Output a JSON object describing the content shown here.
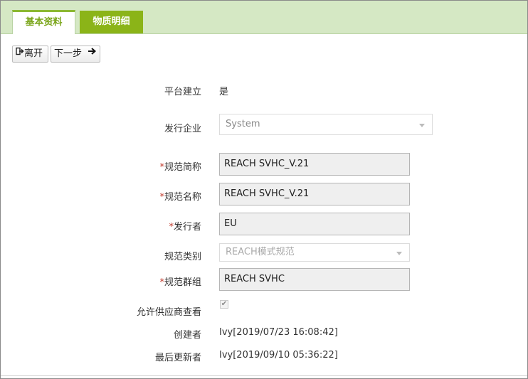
{
  "tabs": [
    {
      "label": "基本资料",
      "active": true
    },
    {
      "label": "物质明细",
      "active": false
    }
  ],
  "toolbar": {
    "leave_label": "离开",
    "next_label": "下一步"
  },
  "form": {
    "platform_created": {
      "label": "平台建立",
      "value": "是"
    },
    "issuing_company": {
      "label": "发行企业",
      "value": "System"
    },
    "spec_short_name": {
      "label": "规范简称",
      "required_mark": "*",
      "value": "REACH SVHC_V.21"
    },
    "spec_name": {
      "label": "规范名称",
      "required_mark": "*",
      "value": "REACH SVHC_V.21"
    },
    "issuer": {
      "label": "发行者",
      "required_mark": "*",
      "value": "EU"
    },
    "spec_category": {
      "label": "规范类别",
      "value": "REACH模式规范"
    },
    "spec_group": {
      "label": "规范群组",
      "required_mark": "*",
      "value": "REACH SVHC"
    },
    "allow_supplier_view": {
      "label": "允许供应商查看",
      "checked": true
    },
    "creator": {
      "label": "创建者",
      "value": "Ivy[2019/07/23 16:08:42]"
    },
    "last_updater": {
      "label": "最后更新者",
      "value": "Ivy[2019/09/10 05:36:22]"
    }
  },
  "colors": {
    "tabbar_bg": "#d5e8c4",
    "active_tab_text": "#7aa51a",
    "inactive_tab_bg": "#8bb418",
    "required_mark": "#c0392b"
  }
}
